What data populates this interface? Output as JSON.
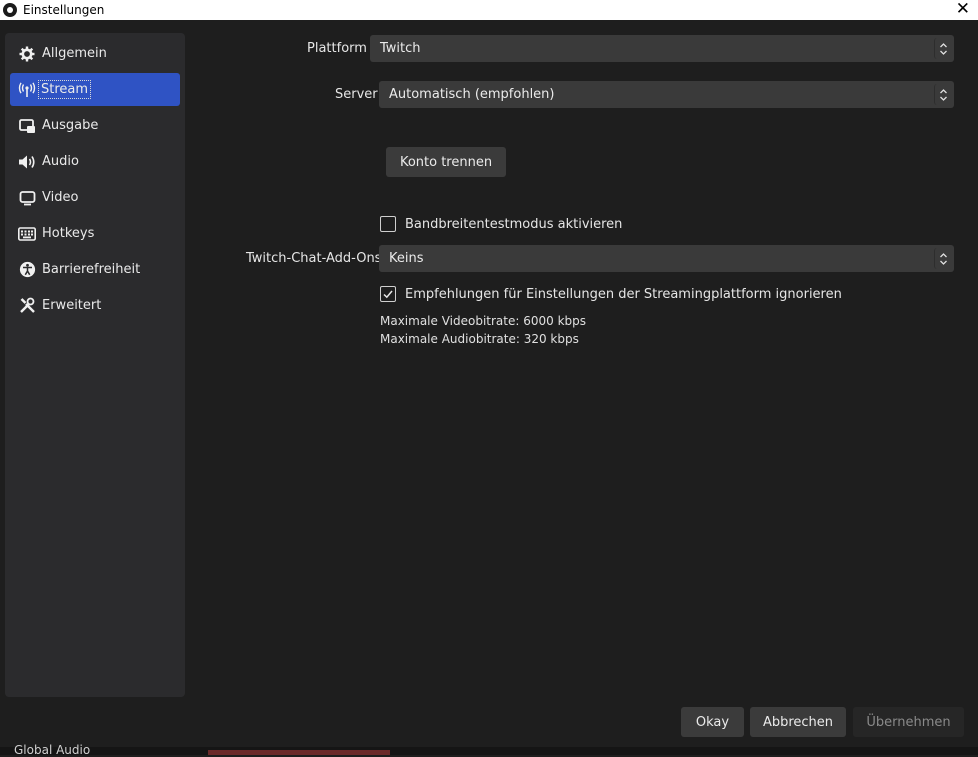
{
  "window": {
    "title": "Einstellungen"
  },
  "sidebar": {
    "items": [
      {
        "label": "Allgemein",
        "icon": "gear-icon",
        "active": false
      },
      {
        "label": "Stream",
        "icon": "broadcast-icon",
        "active": true
      },
      {
        "label": "Ausgabe",
        "icon": "output-icon",
        "active": false
      },
      {
        "label": "Audio",
        "icon": "speaker-icon",
        "active": false
      },
      {
        "label": "Video",
        "icon": "monitor-icon",
        "active": false
      },
      {
        "label": "Hotkeys",
        "icon": "keyboard-icon",
        "active": false
      },
      {
        "label": "Barrierefreiheit",
        "icon": "accessibility-icon",
        "active": false
      },
      {
        "label": "Erweitert",
        "icon": "tools-icon",
        "active": false
      }
    ]
  },
  "stream": {
    "platform": {
      "label": "Plattform",
      "value": "Twitch"
    },
    "server": {
      "label": "Server",
      "value": "Automatisch (empfohlen)"
    },
    "disconnect_label": "Konto trennen",
    "bandwidth_test": {
      "label": "Bandbreitentestmodus aktivieren",
      "checked": false
    },
    "chat_addons": {
      "label": "Twitch-Chat-Add-Ons",
      "value": "Keins"
    },
    "ignore_recommendations": {
      "label": "Empfehlungen für Einstellungen der Streamingplattform ignorieren",
      "checked": true
    },
    "max_video_bitrate": "Maximale Videobitrate: 6000 kbps",
    "max_audio_bitrate": "Maximale Audiobitrate: 320 kbps"
  },
  "footer": {
    "ok_label": "Okay",
    "cancel_label": "Abbrechen",
    "apply_label": "Übernehmen"
  },
  "background_peek": {
    "text": "Global Audio"
  },
  "colors": {
    "accent": "#2f53c4",
    "background": "#1e1e1e",
    "panel": "#2b2b2d",
    "control": "#3a3a3a"
  }
}
